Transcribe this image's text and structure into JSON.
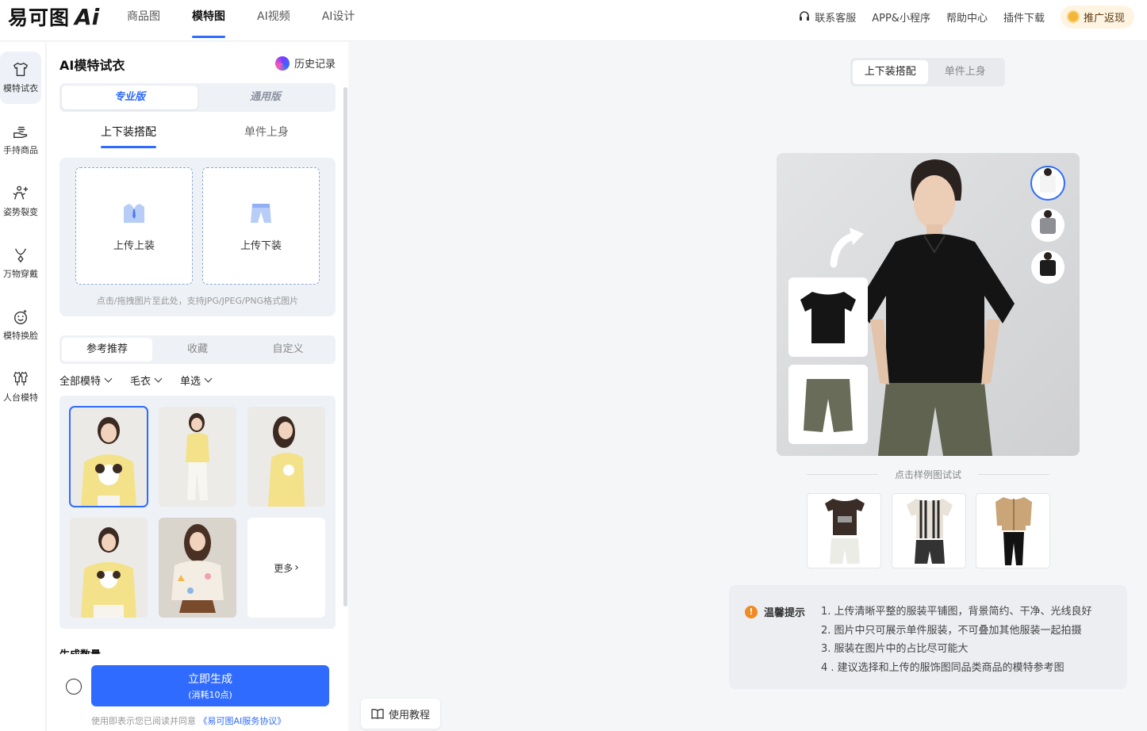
{
  "header": {
    "logo_text": "易可图",
    "logo_ai": "Ai",
    "nav": [
      {
        "label": "商品图",
        "active": false
      },
      {
        "label": "模特图",
        "active": true
      },
      {
        "label": "AI视频",
        "active": false
      },
      {
        "label": "AI设计",
        "active": false
      }
    ],
    "links": {
      "support": "联系客服",
      "app": "APP&小程序",
      "help": "帮助中心",
      "plugin": "插件下载",
      "promo": "推广返现"
    }
  },
  "sidebar": {
    "items": [
      {
        "label": "模特试衣",
        "icon": "shirt-icon"
      },
      {
        "label": "手持商品",
        "icon": "hand-icon"
      },
      {
        "label": "姿势裂变",
        "icon": "pose-icon"
      },
      {
        "label": "万物穿戴",
        "icon": "necklace-icon"
      },
      {
        "label": "模特换脸",
        "icon": "face-icon"
      },
      {
        "label": "人台模特",
        "icon": "mannequin-icon"
      }
    ]
  },
  "panel": {
    "title": "AI模特试衣",
    "history": "历史记录",
    "versions": [
      "专业版",
      "通用版"
    ],
    "sub_tabs": [
      "上下装搭配",
      "单件上身"
    ],
    "upload_top": "上传上装",
    "upload_bottom": "上传下装",
    "upload_hint": "点击/拖拽图片至此处，支持JPG/JPEG/PNG格式图片",
    "ref_tabs": [
      "参考推荐",
      "收藏",
      "自定义"
    ],
    "filters": [
      "全部模特",
      "毛衣",
      "单选"
    ],
    "more": "更多",
    "gen_count_label": "生成数量",
    "generate": "立即生成",
    "generate_cost": "(消耗10点)",
    "agree_text": "使用即表示您已阅读并同意",
    "agree_link": "《易可图AI服务协议》"
  },
  "main": {
    "tabs": [
      "上下装搭配",
      "单件上身"
    ],
    "sample_title": "点击样例图试试",
    "tips_title": "温馨提示",
    "tips": [
      "1. 上传清晰平整的服装平铺图，背景简约、干净、光线良好",
      "2. 图片中只可展示单件服装，不可叠加其他服装一起拍摄",
      "3. 服装在图片中的占比尽可能大",
      "4 . 建议选择和上传的服饰图同品类商品的模特参考图"
    ],
    "tutorial": "使用教程"
  },
  "colors": {
    "accent": "#2f6bff",
    "warning": "#f08a24"
  }
}
